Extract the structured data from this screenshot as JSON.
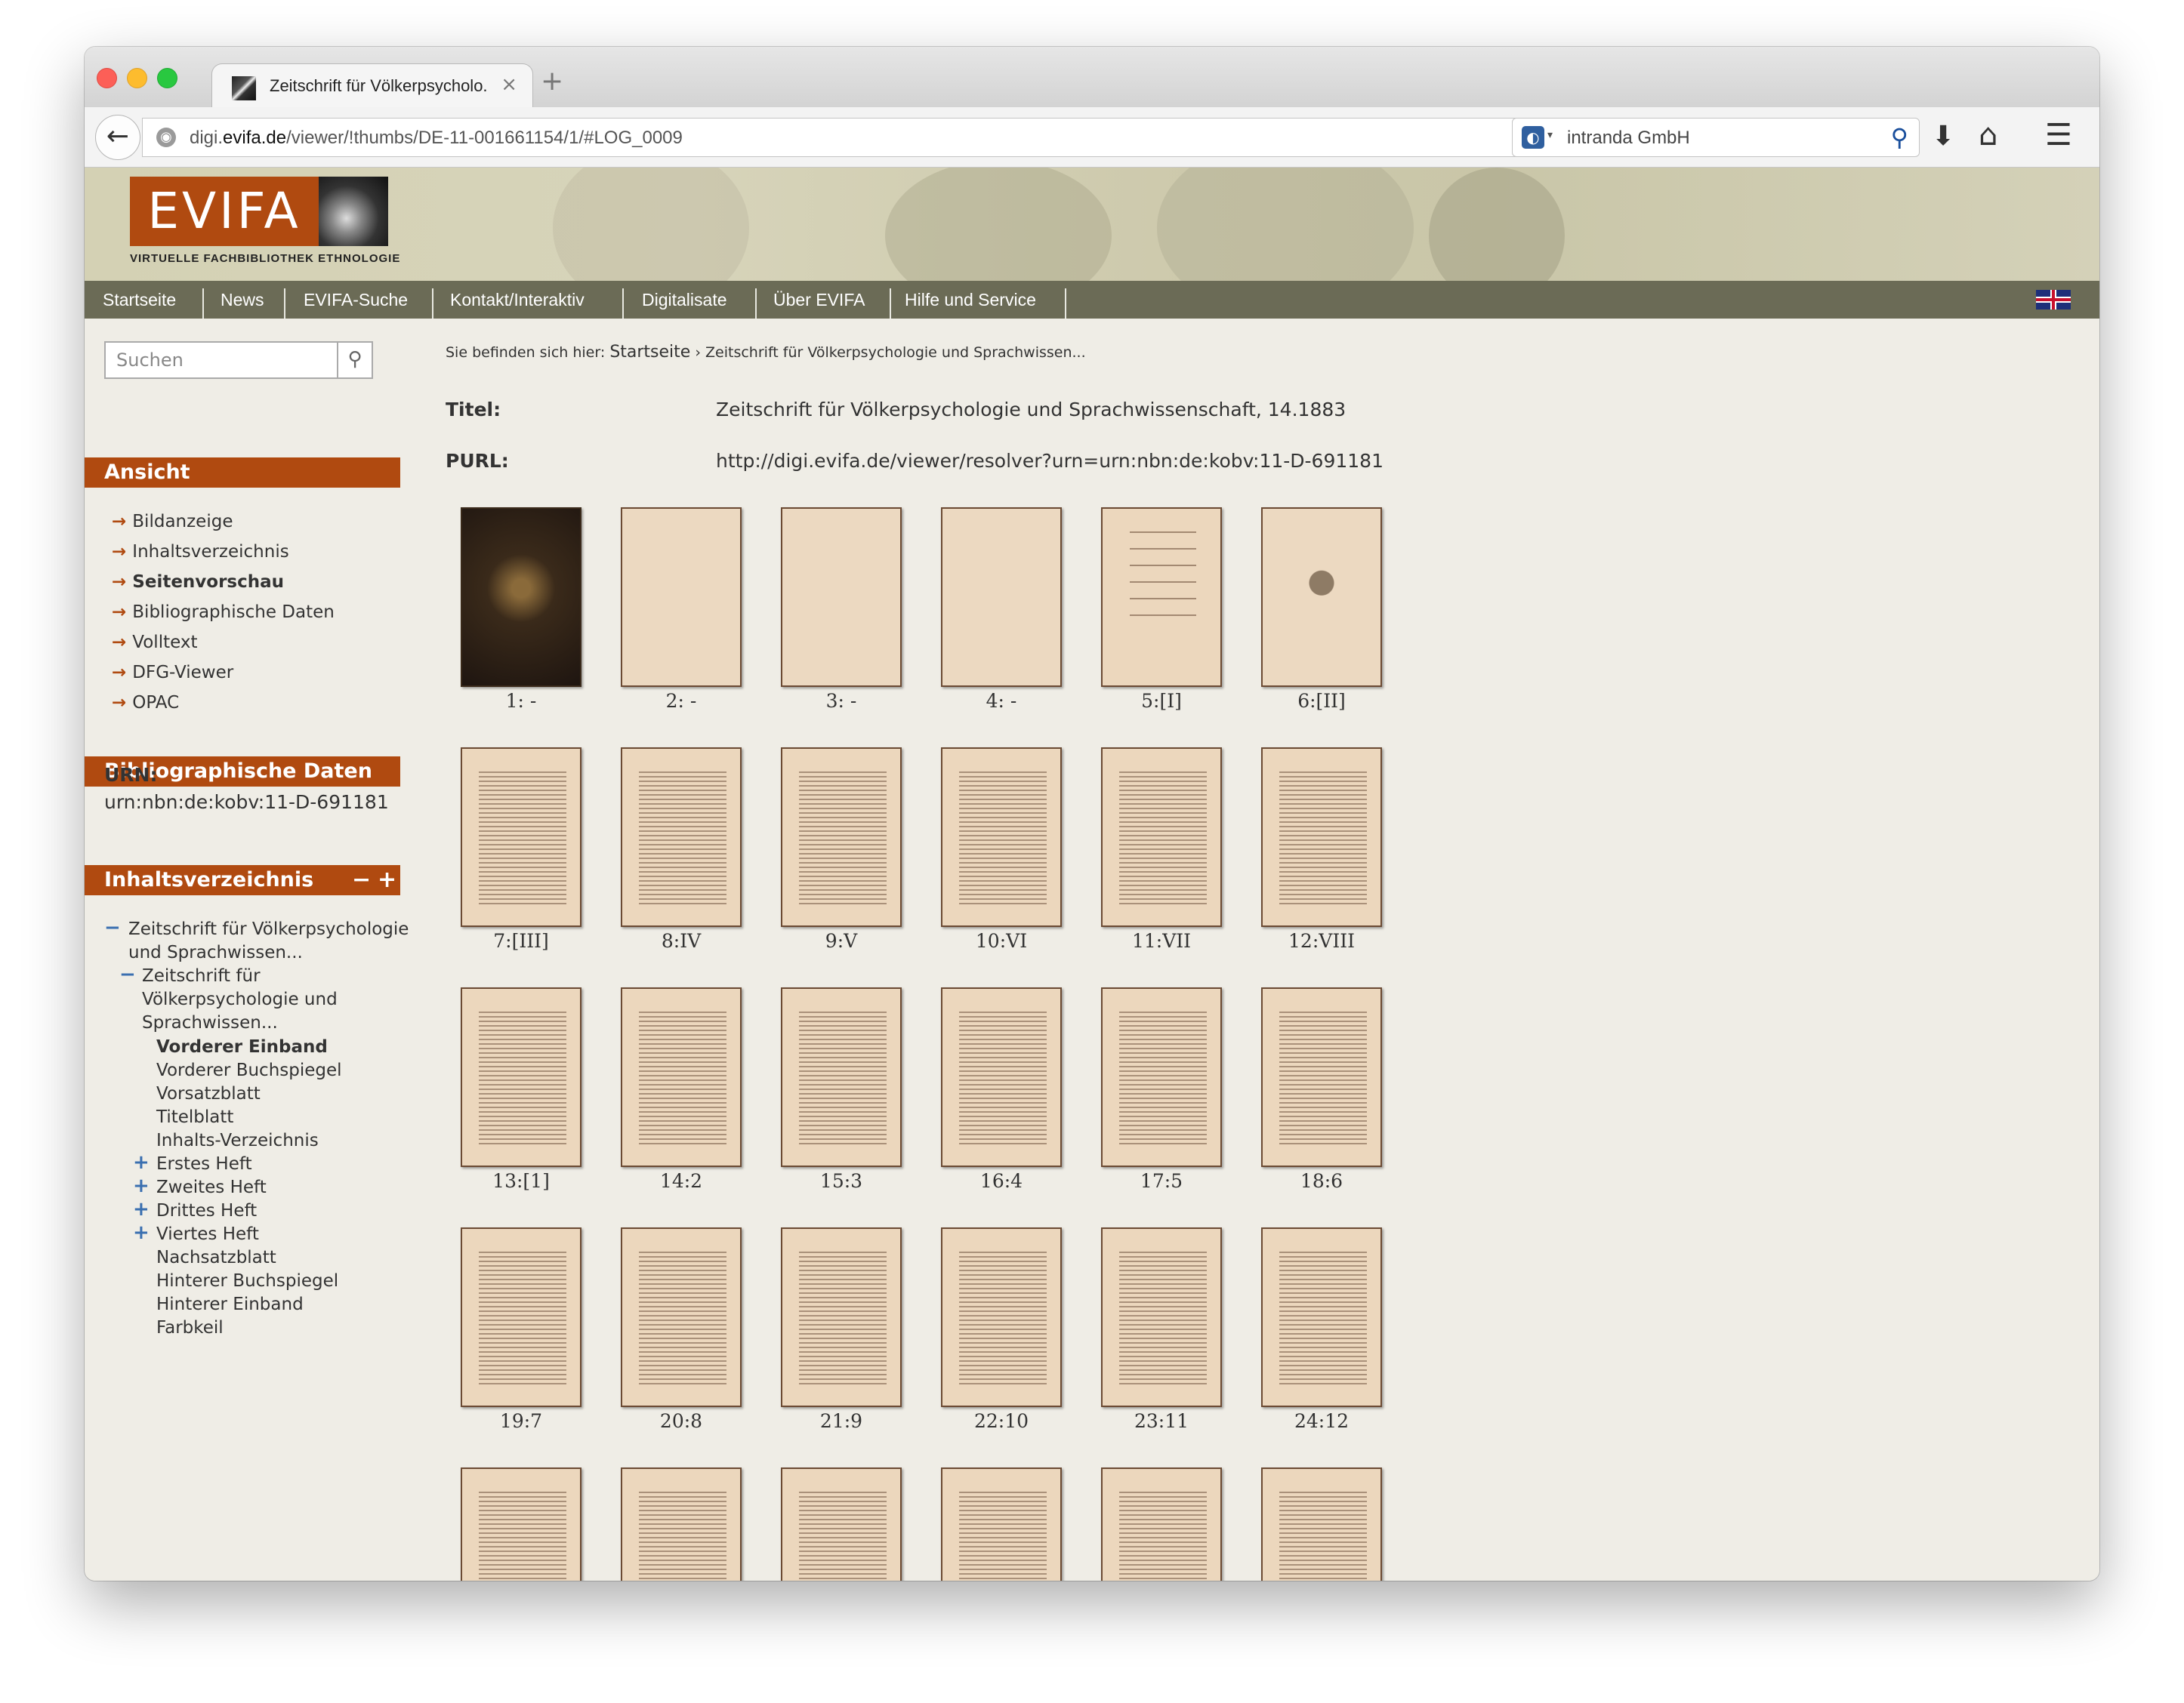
{
  "browser": {
    "tab_title": "Zeitschrift für Völkerpsycholo...",
    "url_prefix": "digi.",
    "url_domain": "evifa.de",
    "url_rest": "/viewer/!thumbs/DE-11-001661154/1/#LOG_0009",
    "search_engine": "intranda GmbH"
  },
  "header": {
    "logo_text": "EVIFA",
    "logo_subtitle": "VIRTUELLE FACHBIBLIOTHEK ETHNOLOGIE"
  },
  "nav": {
    "items": [
      "Startseite",
      "News",
      "EVIFA-Suche",
      "Kontakt/Interaktiv",
      "Digitalisate",
      "Über EVIFA",
      "Hilfe und Service"
    ]
  },
  "sidebar": {
    "search_placeholder": "Suchen",
    "ansicht_title": "Ansicht",
    "ansicht_links": [
      "Bildanzeige",
      "Inhaltsverzeichnis",
      "Seitenvorschau",
      "Bibliographische Daten",
      "Volltext",
      "DFG-Viewer",
      "OPAC"
    ],
    "active_link": "Seitenvorschau",
    "biblio_title": "Bibliographische Daten",
    "urn_label": "URN:",
    "urn_value": "urn:nbn:de:kobv:11-D-691181",
    "toc_title": "Inhaltsverzeichnis",
    "toc_minus": "−",
    "toc_plus": "+",
    "toc_items": [
      "Zeitschrift für Völkerpsychologie",
      "und Sprachwissen...",
      "Zeitschrift für",
      "Völkerpsychologie und",
      "Sprachwissen...",
      "Vorderer Einband",
      "Vorderer Buchspiegel",
      "Vorsatzblatt",
      "Titelblatt",
      "Inhalts-Verzeichnis",
      "Erstes Heft",
      "Zweites Heft",
      "Drittes Heft",
      "Viertes Heft",
      "Nachsatzblatt",
      "Hinterer Buchspiegel",
      "Hinterer Einband",
      "Farbkeil"
    ]
  },
  "main": {
    "breadcrumb_prefix": "Sie befinden sich hier:",
    "breadcrumb_home": "Startseite",
    "breadcrumb_sep": "›",
    "breadcrumb_current": "Zeitschrift für Völkerpsychologie und Sprachwissen...",
    "title_label": "Titel:",
    "title_value": "Zeitschrift für Völkerpsychologie und Sprachwissenschaft, 14.1883",
    "purl_label": "PURL:",
    "purl_value": "http://digi.evifa.de/viewer/resolver?urn=urn:nbn:de:kobv:11-D-691181",
    "thumbnails": [
      "1: -",
      "2: -",
      "3: -",
      "4: -",
      "5:[I]",
      "6:[II]",
      "7:[III]",
      "8:IV",
      "9:V",
      "10:VI",
      "11:VII",
      "12:VIII",
      "13:[1]",
      "14:2",
      "15:3",
      "16:4",
      "17:5",
      "18:6",
      "19:7",
      "20:8",
      "21:9",
      "22:10",
      "23:11",
      "24:12",
      "",
      "",
      "",
      "",
      "",
      ""
    ]
  }
}
